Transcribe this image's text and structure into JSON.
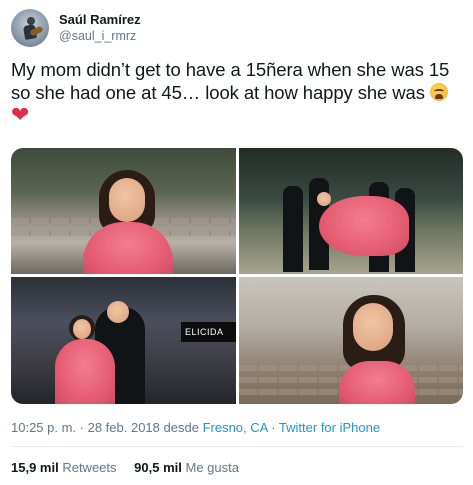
{
  "user": {
    "display_name": "Saúl Ramírez",
    "handle": "@saul_i_rmrz",
    "avatar_icon": "guitar-player-avatar"
  },
  "tweet": {
    "text_line1": "My mom didn’t get to have a 15ñera when she was 15",
    "text_line2": "so she had one at 45… look at how happy she was",
    "emoji1": "weary-face-emoji",
    "emoji2": "❤",
    "photo_sign_text": "ELICIDA"
  },
  "meta": {
    "time": "10:25 p. m.",
    "separator1": " · ",
    "date": "28 feb. 2018",
    "desde": " desde ",
    "location": "Fresno, CA",
    "separator2": " · ",
    "client": "Twitter for iPhone"
  },
  "stats": {
    "retweets_count": "15,9 mil",
    "retweets_label": "Retweets",
    "likes_count": "90,5 mil",
    "likes_label": "Me gusta"
  },
  "colors": {
    "link": "#1b95e0",
    "secondary_text": "#657786",
    "primary_text": "#14171a",
    "dress_pink": "#e65d73"
  }
}
